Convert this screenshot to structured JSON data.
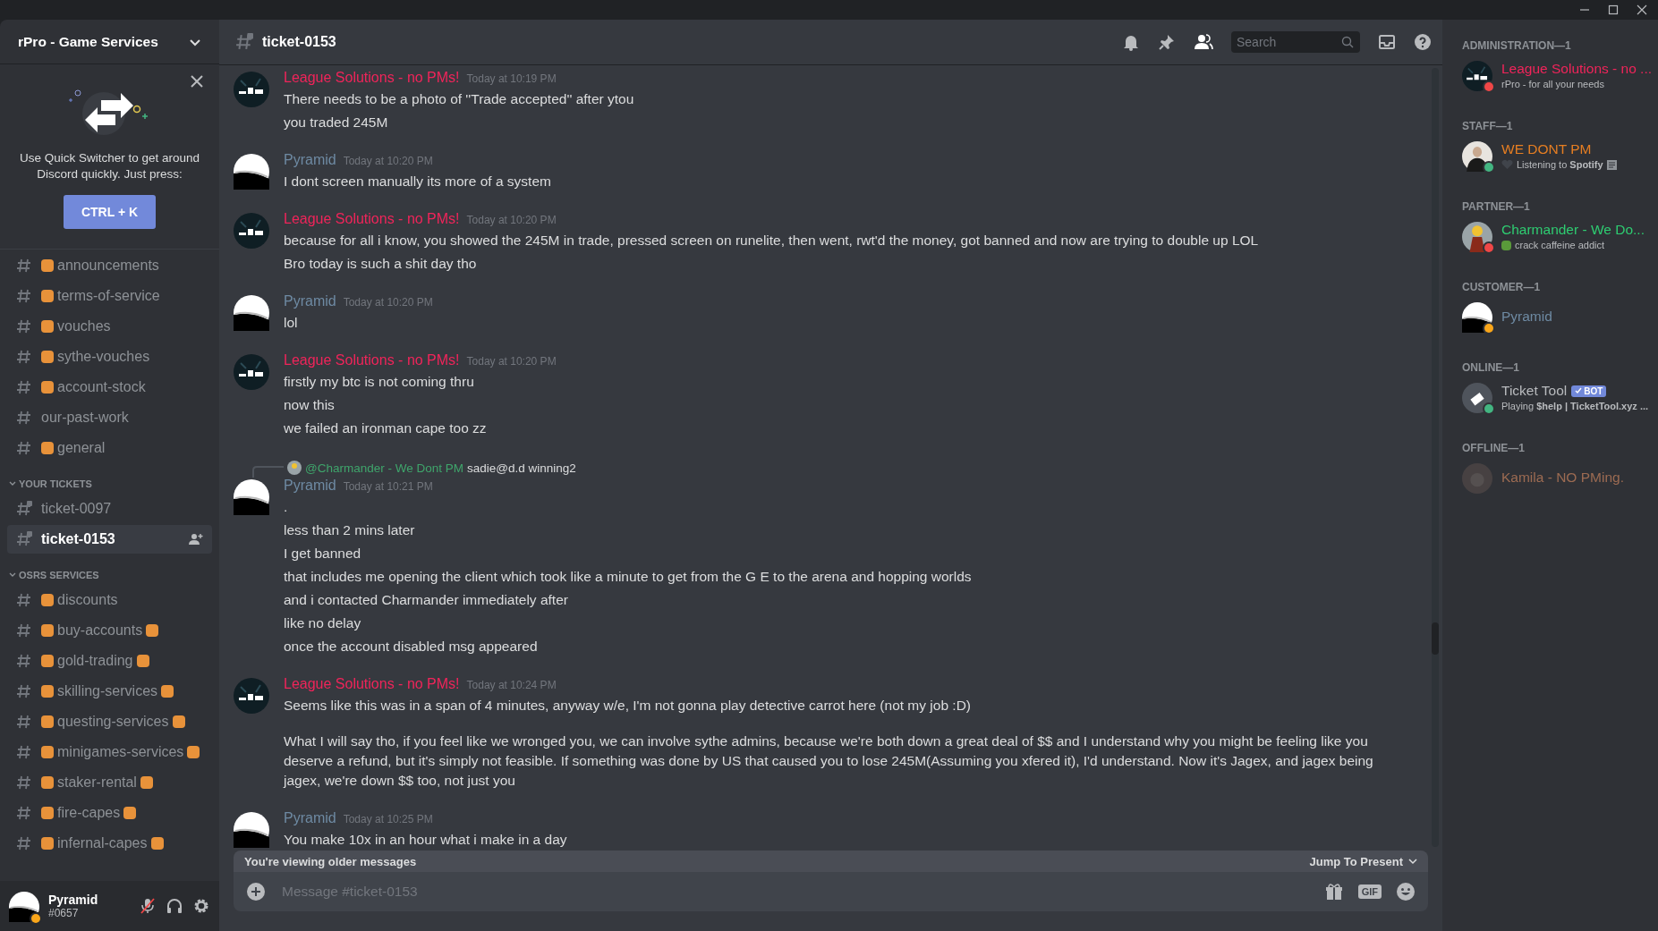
{
  "server": {
    "name": "rPro - Game Services"
  },
  "quick_switcher": {
    "text": "Use Quick Switcher to get around Discord quickly. Just press:",
    "shortcut": "CTRL + K"
  },
  "channel_sections": [
    {
      "channels": [
        {
          "name": "announcements",
          "kind": "text",
          "emoji_before": true,
          "emoji_after": false,
          "selected": false
        },
        {
          "name": "terms-of-service",
          "kind": "text",
          "emoji_before": true,
          "emoji_after": false,
          "selected": false
        },
        {
          "name": "vouches",
          "kind": "text",
          "emoji_before": true,
          "emoji_after": false,
          "selected": false
        },
        {
          "name": "sythe-vouches",
          "kind": "text",
          "emoji_before": true,
          "emoji_after": false,
          "selected": false
        },
        {
          "name": "account-stock",
          "kind": "text",
          "emoji_before": true,
          "emoji_after": false,
          "selected": false
        },
        {
          "name": "our-past-work",
          "kind": "text",
          "emoji_before": false,
          "emoji_after": false,
          "selected": false
        },
        {
          "name": "general",
          "kind": "text",
          "emoji_before": true,
          "emoji_after": false,
          "selected": false
        }
      ]
    },
    {
      "heading": "YOUR TICKETS",
      "expanded": true,
      "channels": [
        {
          "name": "ticket-0097",
          "kind": "ticket",
          "emoji_before": false,
          "emoji_after": false,
          "selected": false
        },
        {
          "name": "ticket-0153",
          "kind": "ticket",
          "emoji_before": false,
          "emoji_after": false,
          "selected": true
        }
      ]
    },
    {
      "heading": "OSRS SERVICES",
      "expanded": true,
      "channels": [
        {
          "name": "discounts",
          "kind": "text",
          "emoji_before": true,
          "emoji_after": false,
          "selected": false
        },
        {
          "name": "buy-accounts",
          "kind": "text",
          "emoji_before": true,
          "emoji_after": true,
          "selected": false
        },
        {
          "name": "gold-trading",
          "kind": "text",
          "emoji_before": true,
          "emoji_after": true,
          "selected": false
        },
        {
          "name": "skilling-services",
          "kind": "text",
          "emoji_before": true,
          "emoji_after": true,
          "selected": false
        },
        {
          "name": "questing-services",
          "kind": "text",
          "emoji_before": true,
          "emoji_after": true,
          "selected": false
        },
        {
          "name": "minigames-services",
          "kind": "text",
          "emoji_before": true,
          "emoji_after": true,
          "selected": false
        },
        {
          "name": "staker-rental",
          "kind": "text",
          "emoji_before": true,
          "emoji_after": true,
          "selected": false
        },
        {
          "name": "fire-capes",
          "kind": "text",
          "emoji_before": true,
          "emoji_after": true,
          "selected": false
        },
        {
          "name": "infernal-capes",
          "kind": "text",
          "emoji_before": true,
          "emoji_after": true,
          "selected": false
        }
      ]
    }
  ],
  "user_panel": {
    "name": "Pyramid",
    "tag": "#0657",
    "status": {
      "color": "#faa61a"
    },
    "muted": true
  },
  "header": {
    "channel": "ticket-0153",
    "search_placeholder": "Search"
  },
  "messages": [
    {
      "author": "League Solutions - no PMs!",
      "color": "#f0245a",
      "kind": "logo",
      "time": "Today at 10:19 PM",
      "lines": [
        "There needs to be a photo of ''Trade accepted'' after ytou",
        "you traded 245M"
      ]
    },
    {
      "author": "Pyramid",
      "color": "#6e8aa3",
      "kind": "pyramid",
      "time": "Today at 10:20 PM",
      "lines": [
        "I dont screen manually its more of a system"
      ]
    },
    {
      "author": "League Solutions - no PMs!",
      "color": "#f0245a",
      "kind": "logo",
      "time": "Today at 10:20 PM",
      "lines": [
        "because for all i know, you showed the 245M in trade, pressed screen on runelite, then went, rwt'd the money, got banned and now are trying to double up LOL",
        "Bro today is such a shit day tho"
      ]
    },
    {
      "author": "Pyramid",
      "color": "#6e8aa3",
      "kind": "pyramid",
      "time": "Today at 10:20 PM",
      "lines": [
        "lol"
      ]
    },
    {
      "author": "League Solutions - no PMs!",
      "color": "#f0245a",
      "kind": "logo",
      "time": "Today at 10:20 PM",
      "lines": [
        "firstly my btc is not coming thru",
        "now this",
        "we failed an ironman cape too zz"
      ]
    },
    {
      "author": "Pyramid",
      "color": "#6e8aa3",
      "kind": "pyramid",
      "time": "Today at 10:21 PM",
      "reply": {
        "mention": "@Charmander - We Dont PM",
        "text": "sadie@d.d winning2"
      },
      "lines": [
        ".",
        "less than 2 mins later",
        "I get banned",
        "that includes me opening the client which took like a minute to get from the G E to the arena and hopping worlds",
        "and i contacted Charmander immediately after",
        "like no delay",
        "once the account disabled msg appeared"
      ]
    },
    {
      "author": "League Solutions - no PMs!",
      "color": "#f0245a",
      "kind": "logo",
      "time": "Today at 10:24 PM",
      "paragraphs": true,
      "lines": [
        "Seems like this was in a span of 4 minutes, anyway w/e, I'm not gonna play detective carrot here (not my job :D)",
        "What I will say tho, if you feel like we wronged you, we can involve sythe admins, because we're both down a great deal of $$ and I understand why you might be feeling like you deserve a refund, but it's simply not feasible. If something was done by US that caused you to lose 245M(Assuming you xfered it), I'd understand. Now it's Jagex, and jagex being jagex, we're down $$ too, not just you"
      ]
    },
    {
      "author": "Pyramid",
      "color": "#6e8aa3",
      "kind": "pyramid",
      "time": "Today at 10:25 PM",
      "lines": [
        "You make 10x in an hour what i make in a day"
      ]
    }
  ],
  "older_bar": {
    "text": "You're viewing older messages",
    "jump": "Jump To Present"
  },
  "composer": {
    "placeholder": "Message #ticket-0153",
    "gif": "GIF"
  },
  "member_groups": [
    {
      "heading": "ADMINISTRATION—1",
      "members": [
        {
          "name": "League Solutions - no ...",
          "color": "#f0245a",
          "kind": "logo",
          "status": {
            "color": "#f04747"
          },
          "offline": false,
          "activity": "rPro - for all your needs"
        }
      ]
    },
    {
      "heading": "STAFF—1",
      "members": [
        {
          "name": "WE DONT PM",
          "color": "#e67e22",
          "kind": "photo",
          "status": {
            "color": "#43b581"
          },
          "offline": false,
          "activity": "Listening to **Spotify**",
          "heart": true,
          "activity_icon": true
        }
      ]
    },
    {
      "heading": "PARTNER—1",
      "members": [
        {
          "name": "Charmander - We Do...",
          "color": "#2ecc71",
          "kind": "character",
          "status": {
            "color": "#f04747"
          },
          "offline": false,
          "activity": "crack caffeine addict",
          "activity_emoji": true
        }
      ]
    },
    {
      "heading": "CUSTOMER—1",
      "members": [
        {
          "name": "Pyramid",
          "color": "#6e8aa3",
          "kind": "pyramid",
          "status": {
            "color": "#faa61a"
          },
          "offline": false
        }
      ]
    },
    {
      "heading": "ONLINE—1",
      "members": [
        {
          "name": "Ticket Tool",
          "color": "#b9bbbe",
          "kind": "ticket",
          "status": {
            "color": "#43b581"
          },
          "offline": false,
          "bot": "BOT",
          "activity": "Playing **$help | TicketTool.xyz ...**"
        }
      ]
    },
    {
      "heading": "OFFLINE—1",
      "members": [
        {
          "name": "Kamila - NO PMing.",
          "color": "#9c6b52",
          "kind": "cat",
          "offline": true
        }
      ]
    }
  ]
}
